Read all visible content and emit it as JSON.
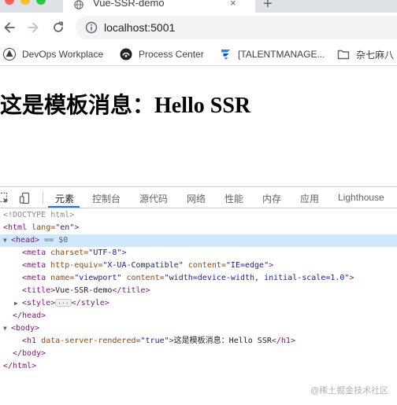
{
  "tab": {
    "title": "Vue-SSR-demo",
    "close": "×"
  },
  "toolbar": {
    "new_tab": "+",
    "url": "localhost:5001"
  },
  "bookmarks": [
    {
      "label": "DevOps Workplace",
      "icon": "devops-icon"
    },
    {
      "label": "Process Center",
      "icon": "process-center-icon"
    },
    {
      "label": "[TALENTMANAGE...",
      "icon": "talent-icon"
    },
    {
      "label": "杂七麻八",
      "icon": "folder-icon"
    }
  ],
  "page": {
    "heading": "这是模板消息：Hello SSR"
  },
  "devtools": {
    "tabs": [
      "元素",
      "控制台",
      "源代码",
      "网络",
      "性能",
      "内存",
      "应用",
      "Lighthouse"
    ],
    "active_tab": "元素",
    "tree": {
      "doctype": "<!DOCTYPE html>",
      "html_open": "<html",
      "lang_attr": " lang=",
      "lang_val": "\"en\"",
      "gt": ">",
      "head_open": "<head>",
      "head_marker": " == $0",
      "meta": "<meta",
      "charset_attr": " charset=",
      "charset_val": "\"UTF-8\"",
      "http_equiv_attr": " http-equiv=",
      "http_equiv_val": "\"X-UA-Compatible\"",
      "content_attr": " content=",
      "ie_val": "\"IE=edge\"",
      "name_attr": " name=",
      "viewport_val": "\"viewport\"",
      "viewport_content_val": "\"width=device-width, initial-scale=1.0\"",
      "title_open": "<title>",
      "title_text": "Vue-SSR-demo",
      "title_close": "</title>",
      "style_open": "<style>",
      "style_ellipsis": "···",
      "style_close": "</style>",
      "head_close": "</head>",
      "body_open": "<body>",
      "h1_open": "<h1",
      "ssr_attr": " data-server-rendered=",
      "ssr_val": "\"true\"",
      "h1_text": "这是模板消息：Hello SSR",
      "h1_close": "</h1>",
      "body_close": "</body>",
      "html_close": "</html>"
    }
  },
  "watermark": "@稀土掘金技术社区",
  "colors": {
    "tabstrip": "#dee1e6",
    "tag": "#881280",
    "attr": "#994500",
    "value": "#1a1aa6",
    "selection": "#cfe8fc",
    "active_tab_underline": "#1a73e8"
  }
}
